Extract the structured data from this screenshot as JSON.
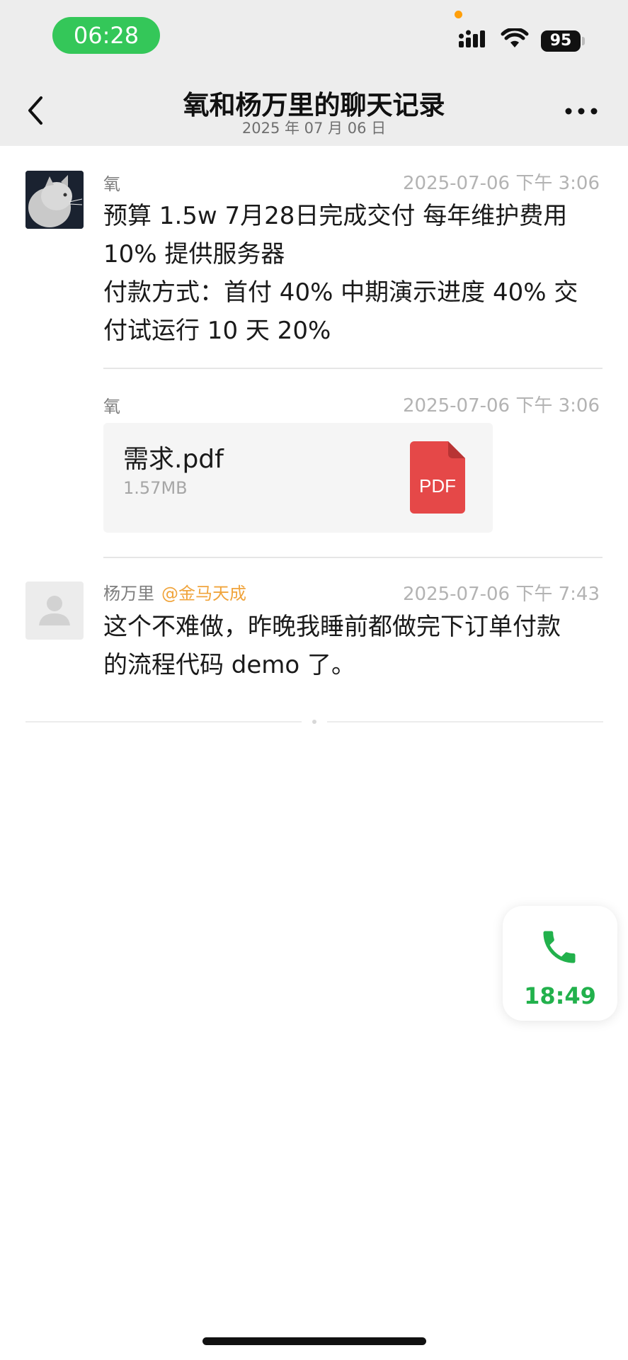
{
  "status_bar": {
    "time": "06:28",
    "battery": "95"
  },
  "header": {
    "title": "氧和杨万里的聊天记录",
    "subtitle": "2025 年 07 月 06 日"
  },
  "messages": [
    {
      "sender": "氧",
      "timestamp": "2025-07-06 下午 3:06",
      "lines": [
        "预算 1.5w  7月28日完成交付  每年维护费用",
        "10% 提供服务器",
        "付款方式：首付 40% 中期演示进度 40% 交",
        "付试运行 10 天 20%"
      ]
    },
    {
      "sender": "氧",
      "timestamp": "2025-07-06 下午 3:06",
      "file": {
        "name": "需求.pdf",
        "size": "1.57MB",
        "badge": "PDF"
      }
    },
    {
      "sender": "杨万里",
      "mention": "@金马天成",
      "timestamp": "2025-07-06 下午 7:43",
      "lines": [
        "这个不难做，昨晚我睡前都做完下订单付款",
        "的流程代码 demo 了。"
      ]
    }
  ],
  "call": {
    "duration": "18:49"
  },
  "colors": {
    "accent_green": "#34c759",
    "call_green": "#22b14c",
    "mention_orange": "#f0a43c",
    "pdf_red": "#e54848"
  },
  "icons": [
    "back-icon",
    "more-icon",
    "signal-icon",
    "wifi-icon",
    "battery-icon",
    "pdf-file-icon",
    "phone-icon",
    "default-avatar-icon"
  ]
}
